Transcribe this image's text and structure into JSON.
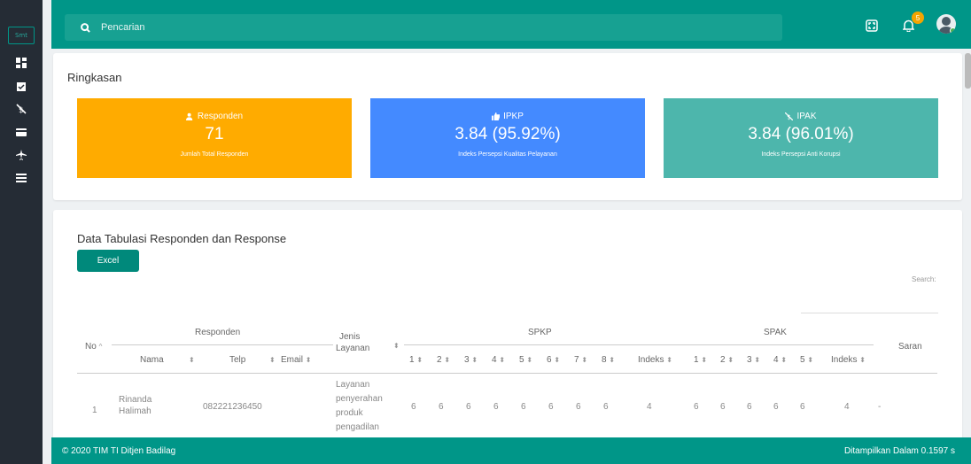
{
  "sidebar": {
    "logo": "Smt",
    "icons": [
      "dashboard-icon",
      "clipboard-check-icon",
      "no-bribe-icon",
      "card-icon",
      "plane-icon",
      "list-icon"
    ]
  },
  "topbar": {
    "search_placeholder": "Pencarian",
    "notification_count": "5",
    "colors": {
      "primary": "#009688",
      "sidebar": "#252c35"
    }
  },
  "summary": {
    "title": "Ringkasan",
    "cards": [
      {
        "icon": "users-icon",
        "label": "Responden",
        "value": "71",
        "sub": "Jumlah Total Responden",
        "color": "#ffab00"
      },
      {
        "icon": "thumbs-up-icon",
        "label": "IPKP",
        "value": "3.84 (95.92%)",
        "sub": "Indeks Persepsi Kualitas Pelayanan",
        "color": "#448aff"
      },
      {
        "icon": "no-bribe-icon",
        "label": "IPAK",
        "value": "3.84 (96.01%)",
        "sub": "Indeks Persepsi Anti Korupsi",
        "color": "#4db6ac"
      }
    ]
  },
  "table_section": {
    "title": "Data Tabulasi Responden dan Response",
    "excel_label": "Excel",
    "search_label": "Search:",
    "headers": {
      "no": "No",
      "responden": "Responden",
      "nama": "Nama",
      "telp": "Telp",
      "email": "Email",
      "jenis": "Jenis",
      "layanan": "Layanan",
      "spkp": "SPKP",
      "spak": "SPAK",
      "saran": "Saran",
      "spkp_cols": [
        "1",
        "2",
        "3",
        "4",
        "5",
        "6",
        "7",
        "8",
        "Indeks"
      ],
      "spak_cols": [
        "1",
        "2",
        "3",
        "4",
        "5",
        "Indeks"
      ]
    },
    "rows": [
      {
        "no": "1",
        "nama_1": "Rinanda",
        "nama_2": "Halimah",
        "telp": "082221236450",
        "layanan_lines": [
          "Layanan",
          "penyerahan",
          "produk",
          "pengadilan"
        ],
        "spkp": [
          "6",
          "6",
          "6",
          "6",
          "6",
          "6",
          "6",
          "6",
          "4"
        ],
        "spak": [
          "6",
          "6",
          "6",
          "6",
          "6",
          "4"
        ],
        "saran": "-"
      }
    ]
  },
  "footer": {
    "prefix": "© 2020",
    "org": "TIM TI Ditjen Badilag",
    "timing": "Ditampilkan Dalam 0.1597 s"
  }
}
